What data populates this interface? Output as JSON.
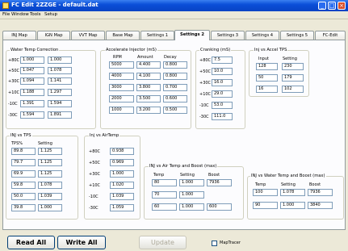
{
  "window": {
    "title": "FC Edit 2ZZGE - default.dat",
    "minimize": "_",
    "maximize": "□",
    "close": "×"
  },
  "menu": [
    "File",
    "Window",
    "Tools",
    "Setup"
  ],
  "tabs": [
    "INJ Map",
    "IGN Map",
    "VVT Map",
    "Base Map",
    "Settings 1",
    "Settings 2",
    "Settings 3",
    "Settings 4",
    "Settings 5",
    "FC-Edit"
  ],
  "active_tab": "Settings 2",
  "water_temp": {
    "title": "Water Temp Correction",
    "rows": [
      {
        "label": "+80C",
        "a": "1.000",
        "b": "1.000"
      },
      {
        "label": "+50C",
        "a": "1.047",
        "b": "1.078"
      },
      {
        "label": "+30C",
        "a": "1.094",
        "b": "1.141"
      },
      {
        "label": "+10C",
        "a": "1.188",
        "b": "1.297"
      },
      {
        "label": "-10C",
        "a": "1.391",
        "b": "1.594"
      },
      {
        "label": "-30C",
        "a": "1.594",
        "b": "1.891"
      }
    ]
  },
  "accel_injector": {
    "title": "Accelerate Injector (mS)",
    "headers": [
      "RPM",
      "Amount",
      "Decay"
    ],
    "rows": [
      [
        "5000",
        "4.400",
        "0.800"
      ],
      [
        "4000",
        "4.100",
        "0.800"
      ],
      [
        "3000",
        "3.800",
        "0.700"
      ],
      [
        "2000",
        "3.500",
        "0.600"
      ],
      [
        "1000",
        "3.200",
        "0.500"
      ]
    ]
  },
  "cranking": {
    "title": "Cranking (mS)",
    "rows": [
      {
        "label": "+80C",
        "v": "7.5"
      },
      {
        "label": "+50C",
        "v": "10.0"
      },
      {
        "label": "+30C",
        "v": "16.0"
      },
      {
        "label": "+10C",
        "v": "29.0"
      },
      {
        "label": "-10C",
        "v": "53.0"
      },
      {
        "label": "-30C",
        "v": "111.0"
      }
    ]
  },
  "inj_accel_tps": {
    "title": "Inj vs Accel TPS",
    "headers": [
      "Input",
      "Setting"
    ],
    "rows": [
      [
        "128",
        "230"
      ],
      [
        "50",
        "179"
      ],
      [
        "16",
        "102"
      ]
    ]
  },
  "inj_tps": {
    "title": "INJ vs TPS",
    "headers": [
      "TPS%",
      "Setting"
    ],
    "rows": [
      [
        "89.8",
        "1.125"
      ],
      [
        "79.7",
        "1.125"
      ],
      [
        "69.9",
        "1.125"
      ],
      [
        "59.8",
        "1.078"
      ],
      [
        "50.0",
        "1.039"
      ],
      [
        "39.8",
        "1.000"
      ]
    ]
  },
  "inj_airtemp": {
    "title": "Inj vs AirTemp",
    "rows": [
      {
        "label": "+80C",
        "v": "0.938"
      },
      {
        "label": "+50C",
        "v": "0.969"
      },
      {
        "label": "+30C",
        "v": "1.000"
      },
      {
        "label": "+10C",
        "v": "1.020"
      },
      {
        "label": "-10C",
        "v": "1.039"
      },
      {
        "label": "-30C",
        "v": "1.059"
      }
    ]
  },
  "inj_air_boost": {
    "title": "INJ vs Air Temp and Boost (max)",
    "headers": [
      "Temp",
      "Setting",
      "Boost"
    ],
    "rows": [
      [
        "80",
        "1.000",
        "7936"
      ],
      [
        "70",
        "1.000",
        ""
      ],
      [
        "60",
        "1.000",
        "600"
      ]
    ]
  },
  "inj_water_boost": {
    "title": "INJ vs Water Temp and Boost (max)",
    "headers": [
      "Temp",
      "Setting",
      "Boost"
    ],
    "rows": [
      [
        "100",
        "1.078",
        "7936"
      ],
      [
        "90",
        "1.000",
        "3840"
      ]
    ]
  },
  "bottom": {
    "read_all": "Read All",
    "write_all": "Write All",
    "update": "Update",
    "maptracer": "MapTracer"
  }
}
